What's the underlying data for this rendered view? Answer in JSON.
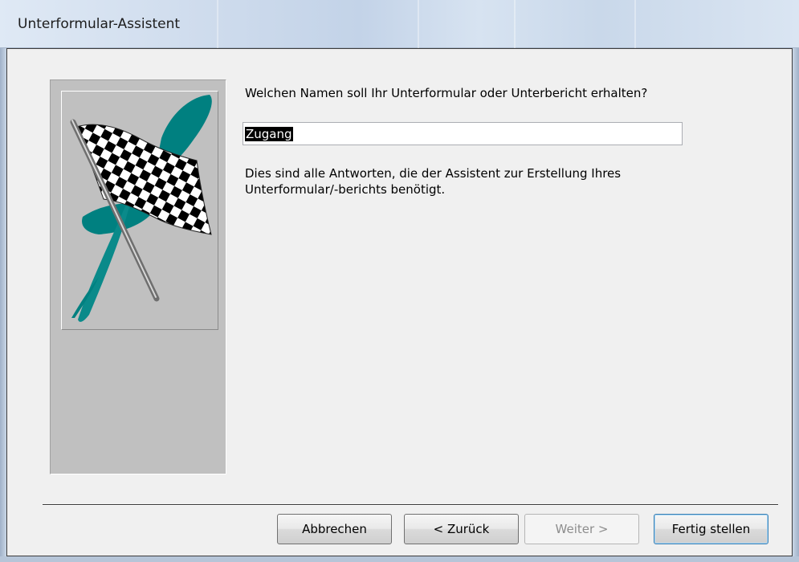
{
  "window": {
    "title": "Unterformular-Assistent"
  },
  "wizard": {
    "question": "Welchen Namen soll Ihr Unterformular oder Unterbericht erhalten?",
    "name_value": "Zugang",
    "info_line1": "Dies sind alle Antworten, die der Assistent zur Erstellung Ihres",
    "info_line2": "Unterformular/-berichts benötigt."
  },
  "buttons": {
    "cancel": "Abbrechen",
    "back": "< Zurück",
    "next": "Weiter >",
    "finish": "Fertig stellen",
    "next_enabled": false
  },
  "icons": {
    "wizard_art": "checkered-flag-icon"
  },
  "colors": {
    "accent_teal": "#008080",
    "panel_gray": "#c0c0c0",
    "titlebar": "#cfdced"
  }
}
